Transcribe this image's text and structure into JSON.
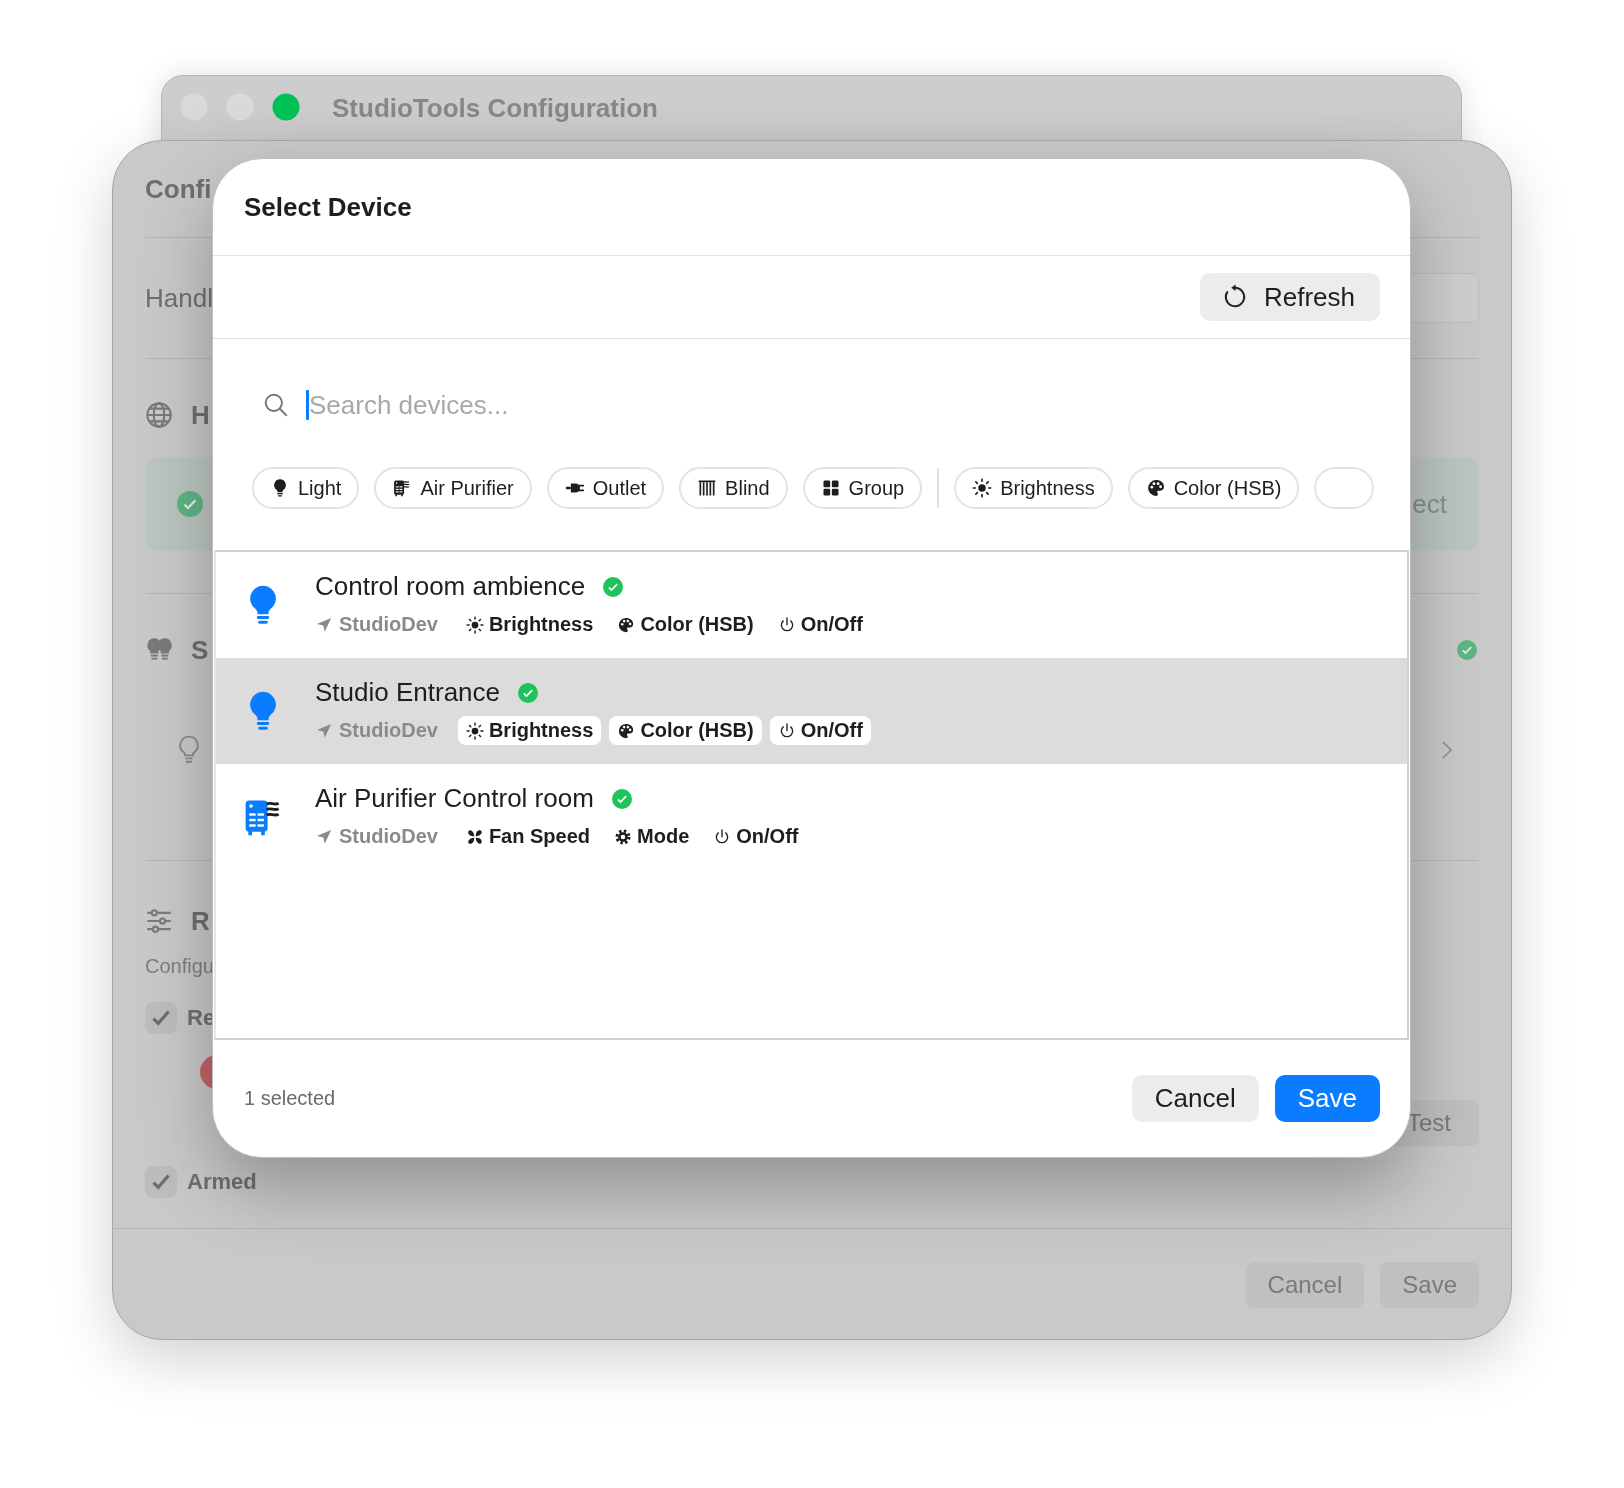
{
  "back_window": {
    "title": "StudioTools Configuration",
    "traffic_lights": [
      {
        "color": "#dadada"
      },
      {
        "color": "#dadada"
      },
      {
        "color": "#00c357"
      }
    ]
  },
  "config_sheet": {
    "title": "Confi",
    "handler_label": "Handl",
    "sections": [
      {
        "title": "H"
      },
      {
        "title": "S"
      },
      {
        "title": "R"
      }
    ],
    "select_button": "ect",
    "description": "Configu",
    "checkboxes": [
      {
        "label": "Re",
        "checked": true
      },
      {
        "label": "Armed",
        "checked": true
      }
    ],
    "test_button": "Test",
    "buttons": [
      "Cancel",
      "Save"
    ]
  },
  "dialog": {
    "title": "Select Device",
    "refresh_button": "Refresh",
    "search": {
      "placeholder": "Search devices..."
    },
    "type_filters": [
      {
        "label": "Light"
      },
      {
        "label": "Air Purifier"
      },
      {
        "label": "Outlet"
      },
      {
        "label": "Blind"
      },
      {
        "label": "Group"
      }
    ],
    "capability_filters": [
      {
        "label": "Brightness"
      },
      {
        "label": "Color (HSB)"
      }
    ],
    "devices": [
      {
        "name": "Control room ambience",
        "kind": "light",
        "online": true,
        "location": "StudioDev",
        "selected": false,
        "capabilities": [
          {
            "label": "Brightness",
            "kind": "brightness"
          },
          {
            "label": "Color (HSB)",
            "kind": "color"
          },
          {
            "label": "On/Off",
            "kind": "power"
          }
        ]
      },
      {
        "name": "Studio Entrance",
        "kind": "light",
        "online": true,
        "location": "StudioDev",
        "selected": true,
        "capabilities": [
          {
            "label": "Brightness",
            "kind": "brightness"
          },
          {
            "label": "Color (HSB)",
            "kind": "color"
          },
          {
            "label": "On/Off",
            "kind": "power"
          }
        ]
      },
      {
        "name": "Air Purifier Control room",
        "kind": "air_purifier",
        "online": true,
        "location": "StudioDev",
        "selected": false,
        "capabilities": [
          {
            "label": "Fan Speed",
            "kind": "fan"
          },
          {
            "label": "Mode",
            "kind": "mode"
          },
          {
            "label": "On/Off",
            "kind": "power"
          }
        ]
      }
    ],
    "selection_count": "1 selected",
    "buttons": [
      {
        "label": "Cancel",
        "kind": "secondary"
      },
      {
        "label": "Save",
        "kind": "primary"
      }
    ]
  }
}
